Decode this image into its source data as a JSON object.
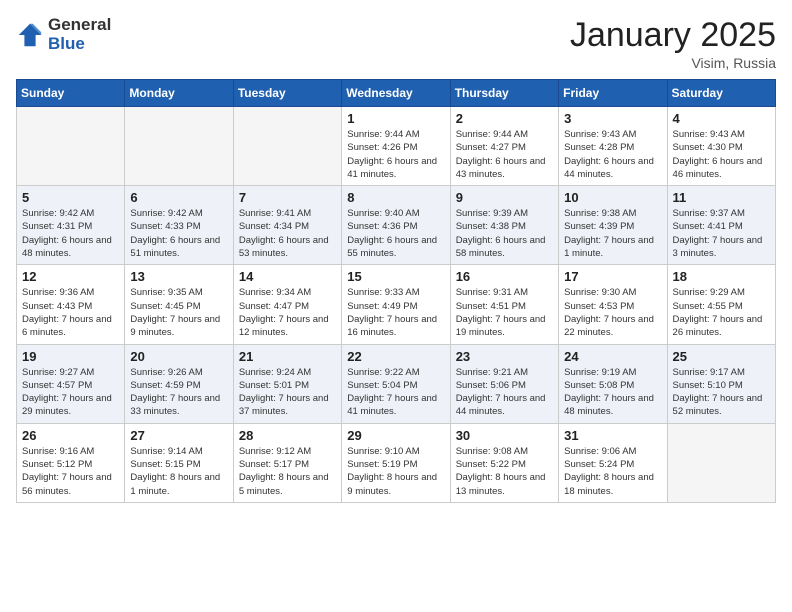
{
  "logo": {
    "general": "General",
    "blue": "Blue"
  },
  "header": {
    "month": "January 2025",
    "location": "Visim, Russia"
  },
  "weekdays": [
    "Sunday",
    "Monday",
    "Tuesday",
    "Wednesday",
    "Thursday",
    "Friday",
    "Saturday"
  ],
  "weeks": [
    {
      "alt": false,
      "days": [
        {
          "num": "",
          "info": ""
        },
        {
          "num": "",
          "info": ""
        },
        {
          "num": "",
          "info": ""
        },
        {
          "num": "1",
          "info": "Sunrise: 9:44 AM\nSunset: 4:26 PM\nDaylight: 6 hours and 41 minutes."
        },
        {
          "num": "2",
          "info": "Sunrise: 9:44 AM\nSunset: 4:27 PM\nDaylight: 6 hours and 43 minutes."
        },
        {
          "num": "3",
          "info": "Sunrise: 9:43 AM\nSunset: 4:28 PM\nDaylight: 6 hours and 44 minutes."
        },
        {
          "num": "4",
          "info": "Sunrise: 9:43 AM\nSunset: 4:30 PM\nDaylight: 6 hours and 46 minutes."
        }
      ]
    },
    {
      "alt": true,
      "days": [
        {
          "num": "5",
          "info": "Sunrise: 9:42 AM\nSunset: 4:31 PM\nDaylight: 6 hours and 48 minutes."
        },
        {
          "num": "6",
          "info": "Sunrise: 9:42 AM\nSunset: 4:33 PM\nDaylight: 6 hours and 51 minutes."
        },
        {
          "num": "7",
          "info": "Sunrise: 9:41 AM\nSunset: 4:34 PM\nDaylight: 6 hours and 53 minutes."
        },
        {
          "num": "8",
          "info": "Sunrise: 9:40 AM\nSunset: 4:36 PM\nDaylight: 6 hours and 55 minutes."
        },
        {
          "num": "9",
          "info": "Sunrise: 9:39 AM\nSunset: 4:38 PM\nDaylight: 6 hours and 58 minutes."
        },
        {
          "num": "10",
          "info": "Sunrise: 9:38 AM\nSunset: 4:39 PM\nDaylight: 7 hours and 1 minute."
        },
        {
          "num": "11",
          "info": "Sunrise: 9:37 AM\nSunset: 4:41 PM\nDaylight: 7 hours and 3 minutes."
        }
      ]
    },
    {
      "alt": false,
      "days": [
        {
          "num": "12",
          "info": "Sunrise: 9:36 AM\nSunset: 4:43 PM\nDaylight: 7 hours and 6 minutes."
        },
        {
          "num": "13",
          "info": "Sunrise: 9:35 AM\nSunset: 4:45 PM\nDaylight: 7 hours and 9 minutes."
        },
        {
          "num": "14",
          "info": "Sunrise: 9:34 AM\nSunset: 4:47 PM\nDaylight: 7 hours and 12 minutes."
        },
        {
          "num": "15",
          "info": "Sunrise: 9:33 AM\nSunset: 4:49 PM\nDaylight: 7 hours and 16 minutes."
        },
        {
          "num": "16",
          "info": "Sunrise: 9:31 AM\nSunset: 4:51 PM\nDaylight: 7 hours and 19 minutes."
        },
        {
          "num": "17",
          "info": "Sunrise: 9:30 AM\nSunset: 4:53 PM\nDaylight: 7 hours and 22 minutes."
        },
        {
          "num": "18",
          "info": "Sunrise: 9:29 AM\nSunset: 4:55 PM\nDaylight: 7 hours and 26 minutes."
        }
      ]
    },
    {
      "alt": true,
      "days": [
        {
          "num": "19",
          "info": "Sunrise: 9:27 AM\nSunset: 4:57 PM\nDaylight: 7 hours and 29 minutes."
        },
        {
          "num": "20",
          "info": "Sunrise: 9:26 AM\nSunset: 4:59 PM\nDaylight: 7 hours and 33 minutes."
        },
        {
          "num": "21",
          "info": "Sunrise: 9:24 AM\nSunset: 5:01 PM\nDaylight: 7 hours and 37 minutes."
        },
        {
          "num": "22",
          "info": "Sunrise: 9:22 AM\nSunset: 5:04 PM\nDaylight: 7 hours and 41 minutes."
        },
        {
          "num": "23",
          "info": "Sunrise: 9:21 AM\nSunset: 5:06 PM\nDaylight: 7 hours and 44 minutes."
        },
        {
          "num": "24",
          "info": "Sunrise: 9:19 AM\nSunset: 5:08 PM\nDaylight: 7 hours and 48 minutes."
        },
        {
          "num": "25",
          "info": "Sunrise: 9:17 AM\nSunset: 5:10 PM\nDaylight: 7 hours and 52 minutes."
        }
      ]
    },
    {
      "alt": false,
      "days": [
        {
          "num": "26",
          "info": "Sunrise: 9:16 AM\nSunset: 5:12 PM\nDaylight: 7 hours and 56 minutes."
        },
        {
          "num": "27",
          "info": "Sunrise: 9:14 AM\nSunset: 5:15 PM\nDaylight: 8 hours and 1 minute."
        },
        {
          "num": "28",
          "info": "Sunrise: 9:12 AM\nSunset: 5:17 PM\nDaylight: 8 hours and 5 minutes."
        },
        {
          "num": "29",
          "info": "Sunrise: 9:10 AM\nSunset: 5:19 PM\nDaylight: 8 hours and 9 minutes."
        },
        {
          "num": "30",
          "info": "Sunrise: 9:08 AM\nSunset: 5:22 PM\nDaylight: 8 hours and 13 minutes."
        },
        {
          "num": "31",
          "info": "Sunrise: 9:06 AM\nSunset: 5:24 PM\nDaylight: 8 hours and 18 minutes."
        },
        {
          "num": "",
          "info": ""
        }
      ]
    }
  ]
}
